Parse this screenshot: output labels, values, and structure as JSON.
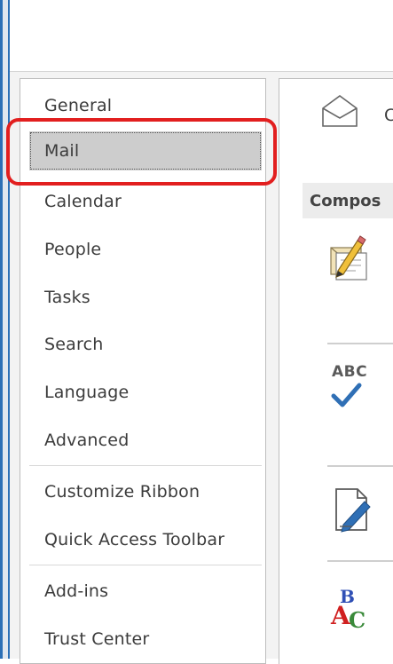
{
  "nav": {
    "items": [
      {
        "label": "General"
      },
      {
        "label": "Mail",
        "selected": true
      },
      {
        "label": "Calendar"
      },
      {
        "label": "People"
      },
      {
        "label": "Tasks"
      },
      {
        "label": "Search"
      },
      {
        "label": "Language"
      },
      {
        "label": "Advanced"
      },
      {
        "label": "Customize Ribbon"
      },
      {
        "label": "Quick Access Toolbar"
      },
      {
        "label": "Add-ins"
      },
      {
        "label": "Trust Center"
      }
    ]
  },
  "main": {
    "header_text": "C",
    "section_title": "Compos",
    "spelling_icon_text": "ABC"
  },
  "colors": {
    "accent": "#2b6fb6",
    "highlight": "#e21f1f",
    "selected_bg": "#cdcdcd",
    "check": "#2f6fb5"
  },
  "icons": [
    "envelope-icon",
    "compose-icon",
    "spelling-check-icon",
    "signature-icon",
    "autocorrect-icon"
  ]
}
